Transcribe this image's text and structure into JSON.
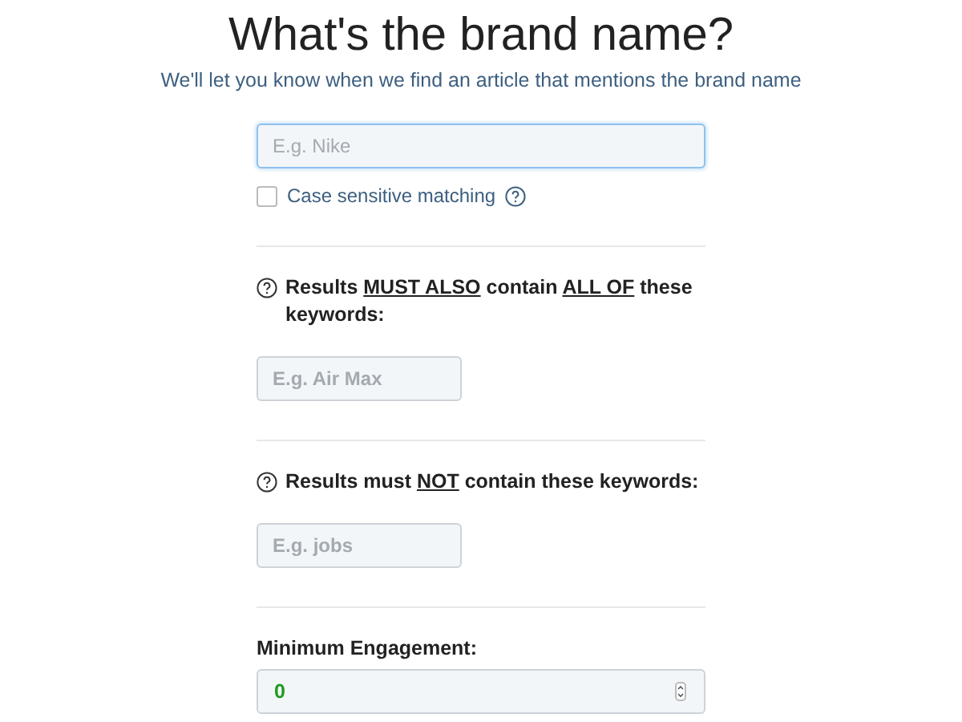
{
  "title": "What's the brand name?",
  "subtitle": "We'll let you know when we find an article that mentions the brand name",
  "brand_field": {
    "placeholder": "E.g. Nike",
    "focused": true
  },
  "case_sensitive": {
    "label": "Case sensitive matching",
    "checked": false
  },
  "sections": [
    {
      "kind": "keywords",
      "heading": [
        {
          "text": "Results ",
          "underline": false
        },
        {
          "text": "MUST ALSO",
          "underline": true
        },
        {
          "text": " contain ",
          "underline": false
        },
        {
          "text": "ALL OF",
          "underline": true
        },
        {
          "text": " these keywords:",
          "underline": false
        }
      ],
      "placeholder": "E.g. Air Max"
    },
    {
      "kind": "keywords",
      "heading": [
        {
          "text": "Results must ",
          "underline": false
        },
        {
          "text": "NOT",
          "underline": true
        },
        {
          "text": " contain these keywords:",
          "underline": false
        }
      ],
      "placeholder": "E.g. jobs"
    }
  ],
  "engagement": {
    "label": "Minimum Engagement:",
    "value": "0"
  }
}
